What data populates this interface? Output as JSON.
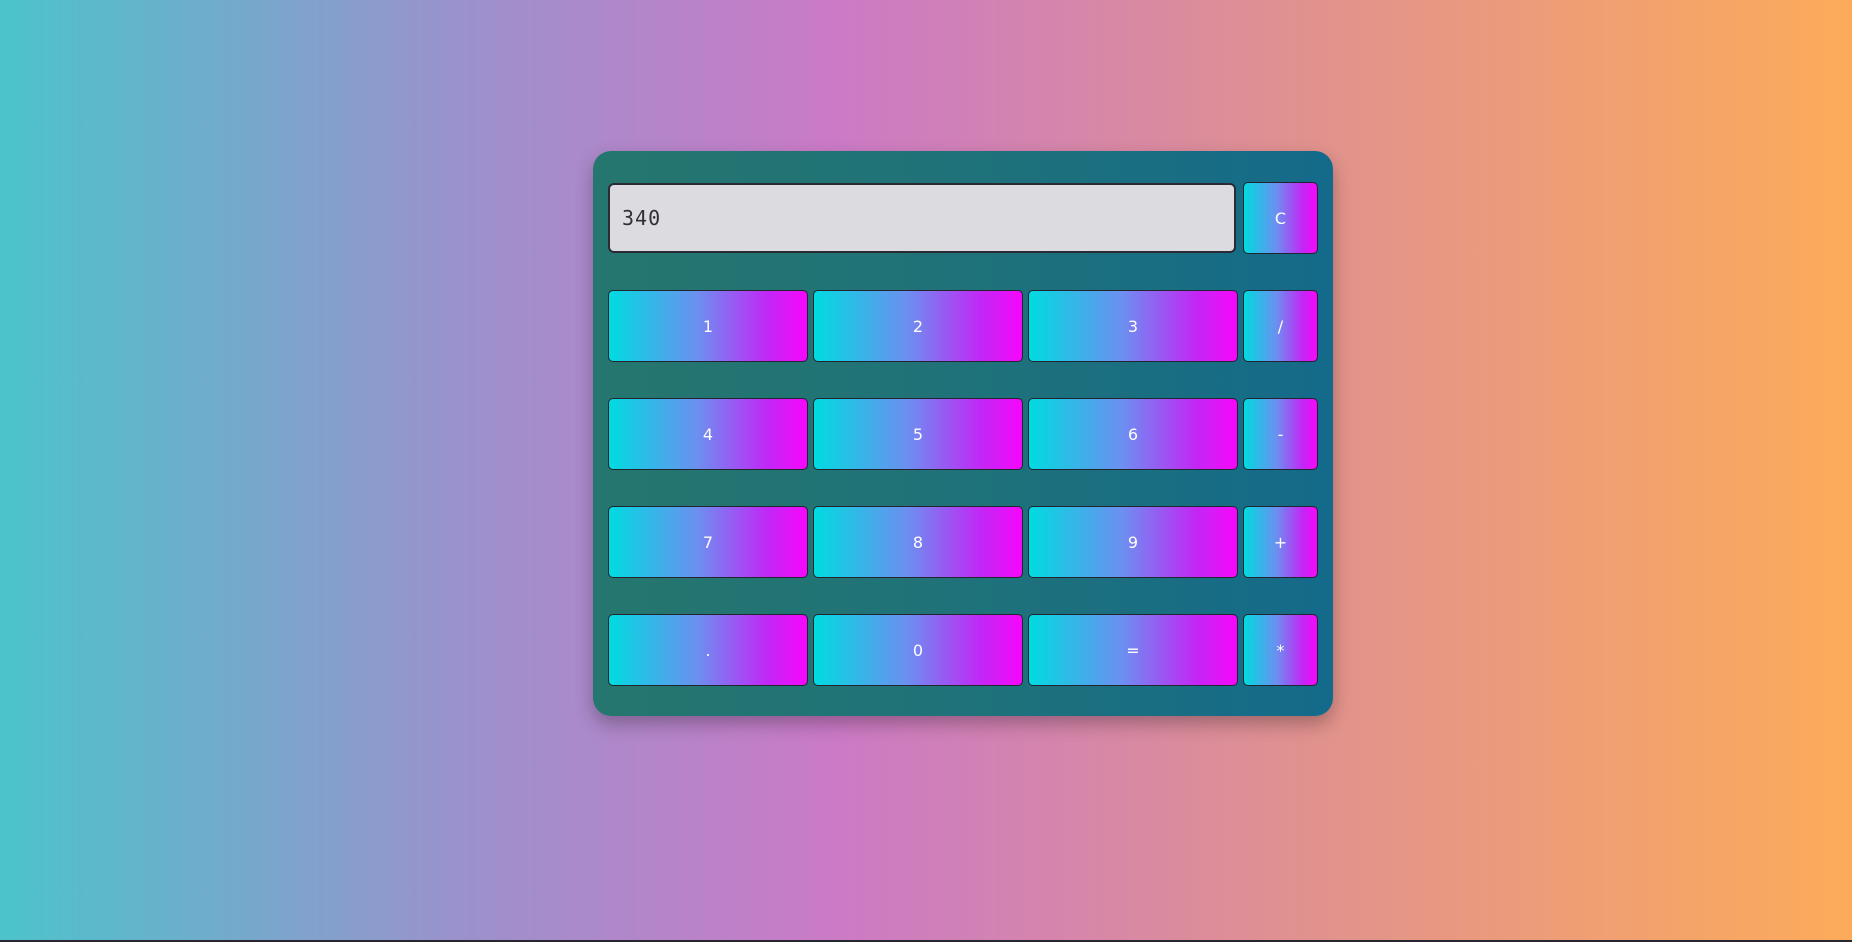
{
  "display": {
    "value": "340"
  },
  "keys": {
    "clear": "C",
    "one": "1",
    "two": "2",
    "three": "3",
    "divide": "/",
    "four": "4",
    "five": "5",
    "six": "6",
    "minus": "-",
    "seven": "7",
    "eight": "8",
    "nine": "9",
    "plus": "+",
    "dot": ".",
    "zero": "0",
    "equals": "=",
    "multiply": "*"
  },
  "colors": {
    "background_start": "#4cc3cb",
    "background_end": "#fdab5a",
    "panel": "#1f7279",
    "key_gradient_start": "#00dbe0",
    "key_gradient_end": "#f706fb",
    "display_bg": "#dcdbe0"
  }
}
